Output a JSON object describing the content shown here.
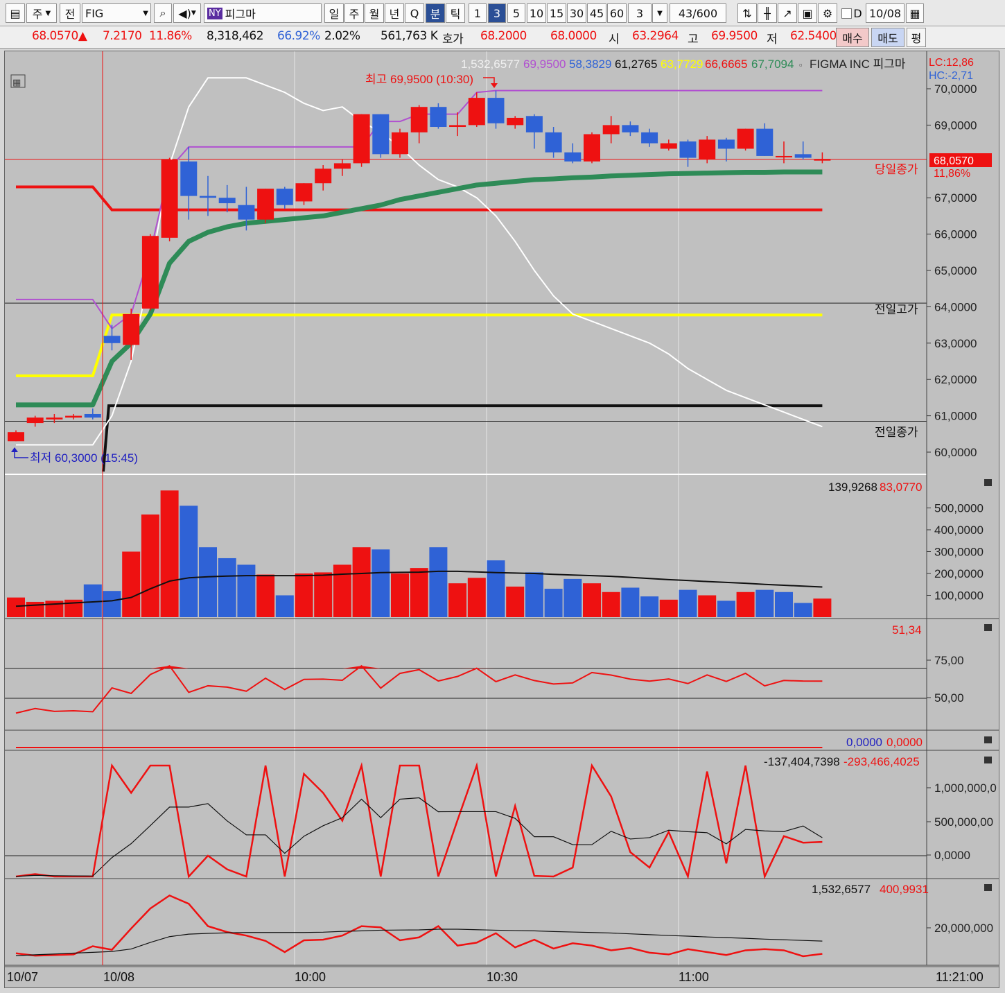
{
  "toolbar": {
    "market_label": "주",
    "market_sub": "전",
    "symbol_code": "FIG",
    "exchange_badge": "NY",
    "symbol_name": "피그마",
    "periods": [
      "일",
      "주",
      "월",
      "년",
      "Q",
      "분",
      "틱"
    ],
    "minute_options": [
      "1",
      "3",
      "5",
      "10",
      "15",
      "30",
      "45",
      "60"
    ],
    "selected_period": "분",
    "selected_minute": "3",
    "count_value": "3",
    "range_value": "43",
    "range_total": "/600",
    "date_checkbox_label": "D",
    "date_value": "10/08"
  },
  "infobar": {
    "price": "68.0570",
    "change": "7.2170",
    "change_pct": "11.86%",
    "volume": "8,318,462",
    "vol_ratio": "66.92%",
    "turnover": "2.02%",
    "amount": "561,763 K",
    "quote_label": "호가",
    "ask": "68.2000",
    "bid": "68.0000",
    "open_label": "시",
    "open": "63.2964",
    "high_label": "고",
    "high": "69.9500",
    "low_label": "저",
    "low": "62.5400",
    "buy_label": "매수",
    "sell_label": "매도",
    "avg_label": "평"
  },
  "colors": {
    "up": "#ee1111",
    "down": "#2f62d6",
    "ma_green": "#2e8b57",
    "prev_high": "#ffff00",
    "purple": "#b050d0",
    "grid_bg": "#c0c0c0"
  },
  "price_panel": {
    "legend": [
      {
        "text": "1,532,6577",
        "color": "#f0f0f0"
      },
      {
        "text": "69,9500",
        "color": "#b050d0"
      },
      {
        "text": "58,3829",
        "color": "#2f62d6"
      },
      {
        "text": "61,2765",
        "color": "#111111"
      },
      {
        "text": "63,7729",
        "color": "#ffff00"
      },
      {
        "text": "66,6665",
        "color": "#ee1111"
      },
      {
        "text": "67,7094",
        "color": "#2e8b57"
      }
    ],
    "title": "FIGMA INC  피그마",
    "lc": "LC:12,86",
    "hc": "HC:-2,71",
    "high_note": "최고 69,9500 (10:30)",
    "low_note": "최저 60,3000 (15:45)",
    "today_close_label": "당일종가",
    "prev_high_label": "전일고가",
    "prev_close_label": "전일종가",
    "current_price_tag": "68,0570",
    "current_pct_tag": "11,86%",
    "y_ticks": [
      "70,0000",
      "69,0000",
      "68,0000",
      "67,0000",
      "66,0000",
      "65,0000",
      "64,0000",
      "63,0000",
      "62,0000",
      "61,0000",
      "60,0000"
    ]
  },
  "volume_panel": {
    "legend_a": "139,9268",
    "legend_b": "83,0770",
    "y_ticks": [
      "500,0000",
      "400,0000",
      "300,0000",
      "200,0000",
      "100,0000"
    ]
  },
  "rsi_panel": {
    "legend": "51,34",
    "y_ticks": [
      "75,00",
      "50,00"
    ]
  },
  "flat_panel": {
    "legend_a": "0,0000",
    "legend_b": "0,0000"
  },
  "obv_panel": {
    "legend_a": "-137,404,7398",
    "legend_b": "-293,466,4025",
    "y_ticks": [
      "1,000,000,0",
      "500,000,00",
      "0,0000"
    ]
  },
  "cum_panel": {
    "legend_a": "1,532,6577",
    "legend_b": "400,9931",
    "y_ticks": [
      "20,000,000"
    ]
  },
  "x_axis": {
    "labels": [
      "10/07",
      "10/08",
      "10:00",
      "10:30",
      "11:00"
    ],
    "time_now": "11:21:00"
  },
  "chart_data": {
    "type": "candlestick",
    "title": "FIGMA INC 피그마",
    "ylim": [
      59.5,
      70.5
    ],
    "candles": [
      {
        "o": 60.3,
        "h": 60.6,
        "l": 60.3,
        "c": 60.55
      },
      {
        "o": 60.8,
        "h": 61.0,
        "l": 60.7,
        "c": 60.95
      },
      {
        "o": 60.9,
        "h": 61.05,
        "l": 60.8,
        "c": 60.95
      },
      {
        "o": 60.95,
        "h": 61.05,
        "l": 60.9,
        "c": 61.0
      },
      {
        "o": 61.05,
        "h": 61.2,
        "l": 60.9,
        "c": 60.95
      },
      {
        "o": 63.2,
        "h": 63.5,
        "l": 62.8,
        "c": 63.0
      },
      {
        "o": 62.95,
        "h": 63.95,
        "l": 62.54,
        "c": 63.8
      },
      {
        "o": 63.95,
        "h": 66.0,
        "l": 63.9,
        "c": 65.95
      },
      {
        "o": 65.9,
        "h": 68.1,
        "l": 65.8,
        "c": 68.05
      },
      {
        "o": 68.0,
        "h": 68.4,
        "l": 66.4,
        "c": 67.05
      },
      {
        "o": 67.05,
        "h": 67.6,
        "l": 66.5,
        "c": 67.0
      },
      {
        "o": 67.0,
        "h": 67.35,
        "l": 66.6,
        "c": 66.85
      },
      {
        "o": 66.8,
        "h": 67.3,
        "l": 66.1,
        "c": 66.4
      },
      {
        "o": 66.4,
        "h": 67.25,
        "l": 66.3,
        "c": 67.25
      },
      {
        "o": 67.25,
        "h": 67.3,
        "l": 66.7,
        "c": 66.8
      },
      {
        "o": 66.9,
        "h": 67.4,
        "l": 66.8,
        "c": 67.4
      },
      {
        "o": 67.4,
        "h": 67.9,
        "l": 67.2,
        "c": 67.8
      },
      {
        "o": 67.8,
        "h": 68.05,
        "l": 67.6,
        "c": 67.95
      },
      {
        "o": 67.95,
        "h": 69.3,
        "l": 67.85,
        "c": 69.3
      },
      {
        "o": 69.3,
        "h": 69.3,
        "l": 68.1,
        "c": 68.2
      },
      {
        "o": 68.2,
        "h": 68.9,
        "l": 68.1,
        "c": 68.8
      },
      {
        "o": 68.8,
        "h": 69.55,
        "l": 68.5,
        "c": 69.5
      },
      {
        "o": 69.5,
        "h": 69.6,
        "l": 68.9,
        "c": 68.95
      },
      {
        "o": 68.95,
        "h": 69.35,
        "l": 68.7,
        "c": 69.0
      },
      {
        "o": 69.0,
        "h": 69.9,
        "l": 68.95,
        "c": 69.75
      },
      {
        "o": 69.75,
        "h": 69.95,
        "l": 68.9,
        "c": 69.05
      },
      {
        "o": 69.0,
        "h": 69.25,
        "l": 68.9,
        "c": 69.2
      },
      {
        "o": 69.25,
        "h": 69.3,
        "l": 68.35,
        "c": 68.8
      },
      {
        "o": 68.8,
        "h": 68.95,
        "l": 68.1,
        "c": 68.25
      },
      {
        "o": 68.25,
        "h": 68.5,
        "l": 67.95,
        "c": 68.0
      },
      {
        "o": 68.0,
        "h": 68.8,
        "l": 67.95,
        "c": 68.75
      },
      {
        "o": 68.75,
        "h": 69.25,
        "l": 68.5,
        "c": 69.0
      },
      {
        "o": 69.0,
        "h": 69.1,
        "l": 68.7,
        "c": 68.8
      },
      {
        "o": 68.8,
        "h": 68.9,
        "l": 68.4,
        "c": 68.5
      },
      {
        "o": 68.35,
        "h": 68.6,
        "l": 68.3,
        "c": 68.5
      },
      {
        "o": 68.55,
        "h": 68.6,
        "l": 67.85,
        "c": 68.1
      },
      {
        "o": 68.05,
        "h": 68.7,
        "l": 67.95,
        "c": 68.6
      },
      {
        "o": 68.6,
        "h": 68.65,
        "l": 68.0,
        "c": 68.35
      },
      {
        "o": 68.35,
        "h": 68.9,
        "l": 68.3,
        "c": 68.9
      },
      {
        "o": 68.9,
        "h": 69.05,
        "l": 68.15,
        "c": 68.15
      },
      {
        "o": 68.15,
        "h": 68.55,
        "l": 67.95,
        "c": 68.15
      },
      {
        "o": 68.2,
        "h": 68.55,
        "l": 68.05,
        "c": 68.1
      },
      {
        "o": 68.05,
        "h": 68.25,
        "l": 67.95,
        "c": 68.06
      }
    ],
    "ma_green": [
      61.3,
      61.3,
      61.3,
      61.3,
      61.3,
      62.5,
      63.0,
      63.8,
      65.2,
      65.8,
      66.05,
      66.2,
      66.3,
      66.35,
      66.4,
      66.45,
      66.5,
      66.6,
      66.7,
      66.8,
      66.95,
      67.05,
      67.15,
      67.25,
      67.35,
      67.4,
      67.45,
      67.5,
      67.52,
      67.55,
      67.57,
      67.6,
      67.62,
      67.64,
      67.66,
      67.67,
      67.68,
      67.69,
      67.7,
      67.7,
      67.71,
      67.71,
      67.71
    ],
    "white_line": [
      60.2,
      60.2,
      60.2,
      60.2,
      60.2,
      61.0,
      62.5,
      65.0,
      67.9,
      69.5,
      70.3,
      70.3,
      70.3,
      70.1,
      69.9,
      69.6,
      69.4,
      69.5,
      69.1,
      68.8,
      68.4,
      67.9,
      67.5,
      67.3,
      67.0,
      66.5,
      65.8,
      65.0,
      64.3,
      63.8,
      63.6,
      63.4,
      63.2,
      63.0,
      62.7,
      62.3,
      62.0,
      61.7,
      61.5,
      61.3,
      61.1,
      60.9,
      60.7
    ],
    "purple_line": [
      64.2,
      64.2,
      64.2,
      64.2,
      64.2,
      63.4,
      63.8,
      65.5,
      67.8,
      68.4,
      68.4,
      68.4,
      68.4,
      68.4,
      68.4,
      68.4,
      68.4,
      68.4,
      68.4,
      69.1,
      69.1,
      69.3,
      69.3,
      69.3,
      69.9,
      69.95,
      69.95,
      69.95,
      69.95,
      69.95,
      69.95,
      69.95,
      69.95,
      69.95,
      69.95,
      69.95,
      69.95,
      69.95,
      69.95,
      69.95,
      69.95,
      69.95,
      69.95
    ],
    "red_level": 66.6665,
    "red_level_before": 67.3,
    "yellow_level": 63.7729,
    "yellow_level_before": 62.1,
    "black_level": 61.2765,
    "prev_high_level": 64.1,
    "prev_close_level": 60.85,
    "today_close_level": 68.06,
    "volume": [
      90000,
      70000,
      75000,
      80000,
      150000,
      120000,
      300000,
      470000,
      580000,
      510000,
      320000,
      270000,
      240000,
      195000,
      100000,
      200000,
      205000,
      240000,
      320000,
      310000,
      200000,
      225000,
      320000,
      155000,
      180000,
      260000,
      140000,
      205000,
      130000,
      175000,
      155000,
      115000,
      135000,
      95000,
      80000,
      125000,
      100000,
      75000,
      115000,
      125000,
      115000,
      65000,
      85000
    ],
    "volume_up": [
      true,
      true,
      true,
      true,
      false,
      false,
      true,
      true,
      true,
      false,
      false,
      false,
      false,
      true,
      false,
      true,
      true,
      true,
      true,
      false,
      true,
      true,
      false,
      true,
      true,
      false,
      true,
      false,
      false,
      false,
      true,
      true,
      false,
      false,
      true,
      false,
      true,
      false,
      true,
      false,
      false,
      false,
      true
    ],
    "volume_ma": [
      50000,
      55000,
      60000,
      65000,
      70000,
      75000,
      90000,
      130000,
      165000,
      180000,
      185000,
      188000,
      190000,
      190000,
      190000,
      190000,
      192000,
      197000,
      200000,
      204000,
      205000,
      206000,
      210000,
      210000,
      207000,
      204000,
      202000,
      200000,
      196000,
      193000,
      190000,
      187000,
      182000,
      177000,
      172000,
      168000,
      163000,
      159000,
      155000,
      150000,
      146000,
      142000,
      138000
    ]
  }
}
